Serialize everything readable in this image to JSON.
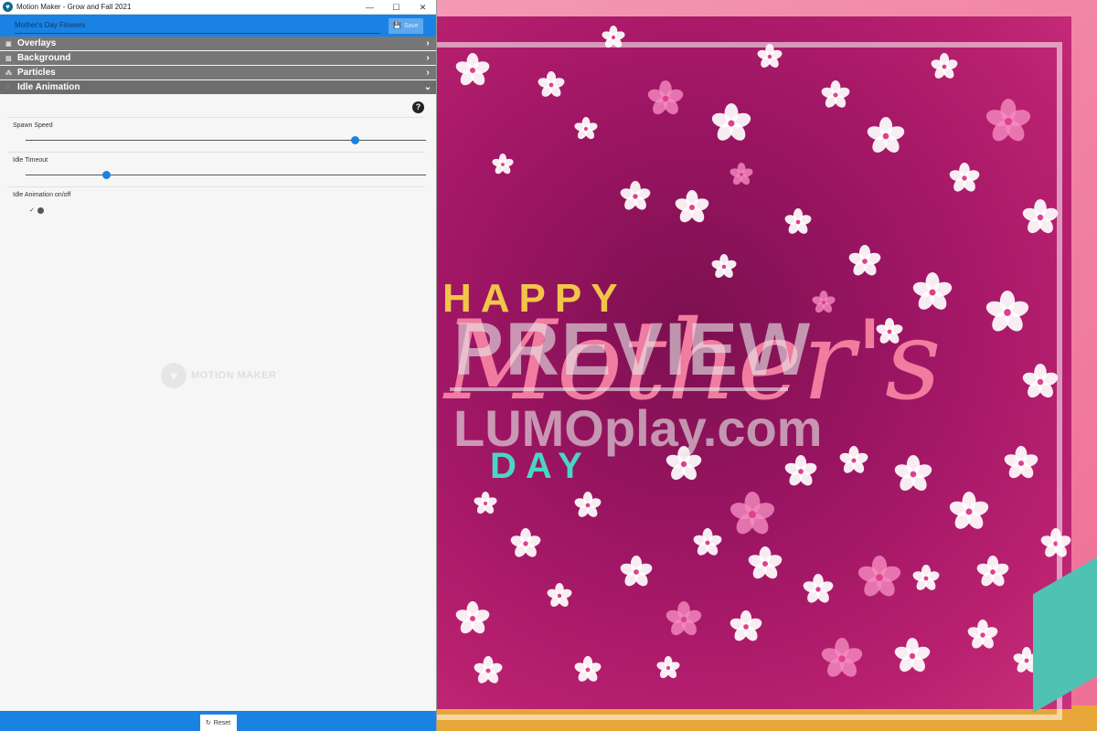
{
  "window": {
    "title": "Motion Maker - Grow and Fall 2021",
    "controls": {
      "minimize": "—",
      "maximize": "☐",
      "close": "✕"
    }
  },
  "topbar": {
    "project_name": "Mother's Day Flowers",
    "save_label": "Save"
  },
  "sections": [
    {
      "label": "Overlays",
      "icon": "▣",
      "chevron": "›",
      "expanded": false
    },
    {
      "label": "Background",
      "icon": "▨",
      "chevron": "›",
      "expanded": false
    },
    {
      "label": "Particles",
      "icon": "⁂",
      "chevron": "›",
      "expanded": false
    },
    {
      "label": "Idle Animation",
      "icon": "◌",
      "chevron": "⌄",
      "expanded": true
    }
  ],
  "idle_animation": {
    "help_icon": "?",
    "spawn_speed": {
      "label": "Spawn Speed",
      "value": 0.823
    },
    "idle_timeout": {
      "label": "Idle Timeout",
      "value": 0.2
    },
    "toggle": {
      "label": "Idle Animation on/off",
      "check": "✓",
      "on": true
    }
  },
  "logo_watermark": {
    "text": "MOTION MAKER"
  },
  "footer": {
    "reset_label": "Reset",
    "reset_icon": "↻"
  },
  "preview": {
    "happy": "HAPPY",
    "script": "Mother's",
    "day": "DAY",
    "watermark_preview": "PREVIEW",
    "watermark_site": "LUMOplay.com"
  },
  "colors": {
    "accent": "#1a82e2",
    "section_bg": "#777777",
    "happy": "#f2c54a",
    "day": "#4ad6c0",
    "script": "#f07ca0"
  }
}
